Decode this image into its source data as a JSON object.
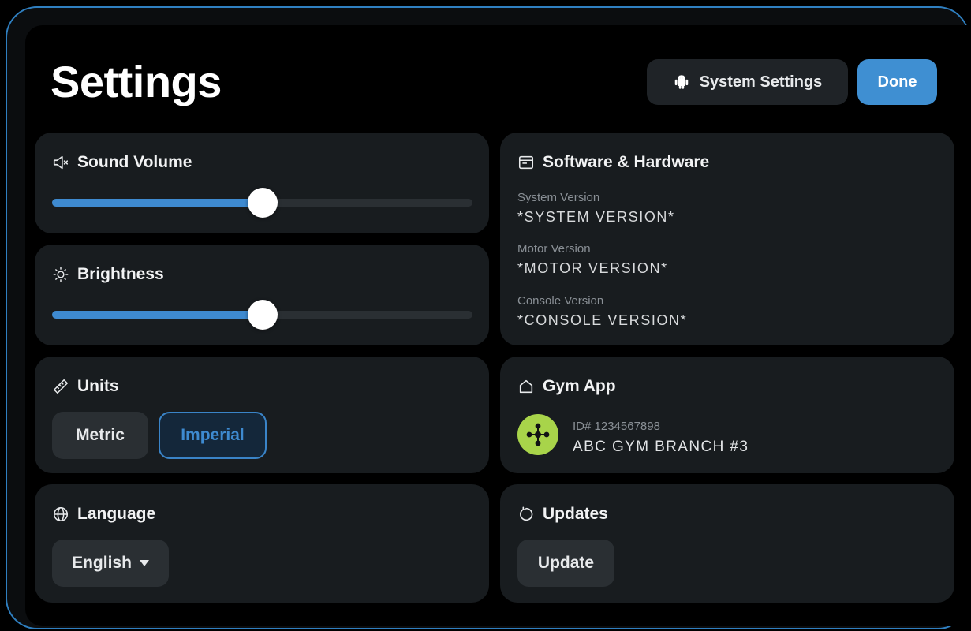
{
  "header": {
    "title": "Settings",
    "system_settings_label": "System Settings",
    "done_label": "Done"
  },
  "sound": {
    "title": "Sound Volume",
    "level": 0.5
  },
  "brightness": {
    "title": "Brightness",
    "level": 0.5
  },
  "units": {
    "title": "Units",
    "options": [
      "Metric",
      "Imperial"
    ],
    "selected": "Imperial"
  },
  "language": {
    "title": "Language",
    "selected": "English"
  },
  "software": {
    "title": "Software & Hardware",
    "system_label": "System Version",
    "system_value": "*SYSTEM VERSION*",
    "motor_label": "Motor Version",
    "motor_value": "*MOTOR VERSION*",
    "console_label": "Console Version",
    "console_value": "*CONSOLE VERSION*"
  },
  "gym": {
    "title": "Gym App",
    "id": "ID# 1234567898",
    "name": "ABC GYM BRANCH #3"
  },
  "updates": {
    "title": "Updates",
    "button_label": "Update"
  },
  "colors": {
    "accent": "#3e8ad0",
    "card": "#181c1f",
    "gym_logo": "#a8d44a"
  },
  "icons": {
    "system_settings": "android-icon",
    "sound": "speaker-muted-icon",
    "brightness": "sun-icon",
    "units": "ruler-icon",
    "language": "globe-icon",
    "software": "window-icon",
    "gym": "home-icon",
    "updates": "refresh-icon"
  }
}
